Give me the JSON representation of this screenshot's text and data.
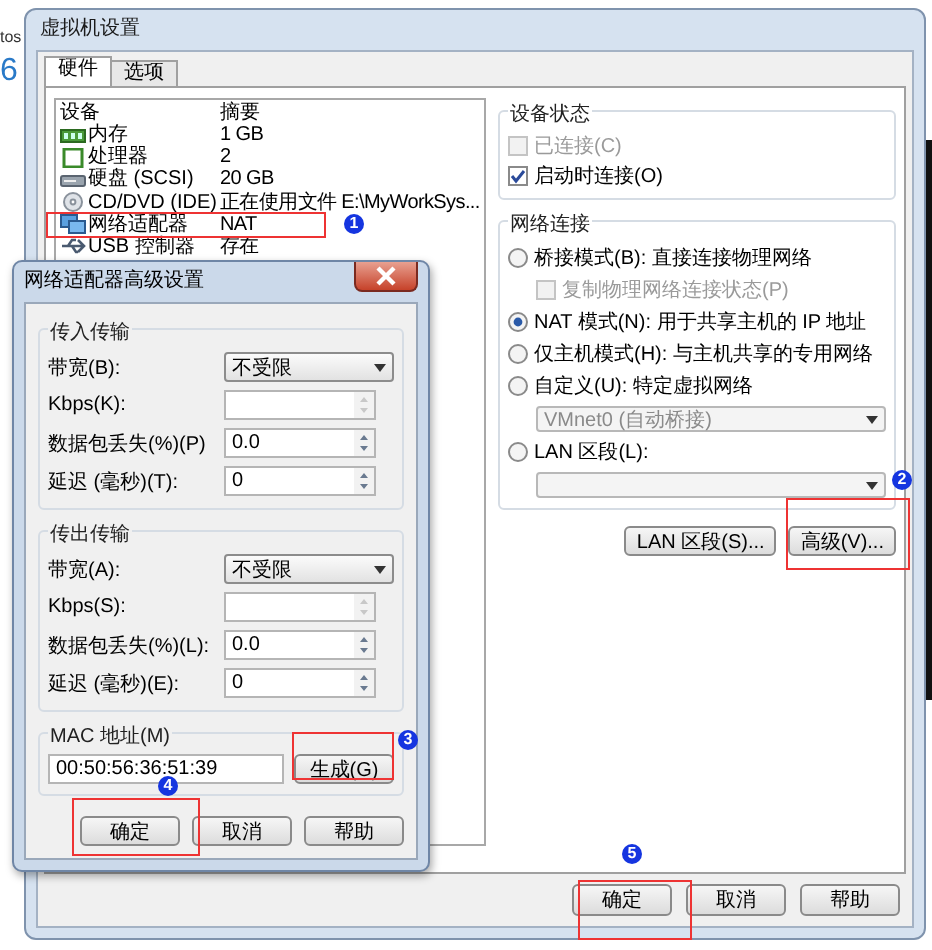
{
  "background_app": {
    "texts": [
      "tos",
      "6"
    ]
  },
  "main_window": {
    "title": "虚拟机设置",
    "tabs": [
      {
        "label": "硬件",
        "selected": true
      },
      {
        "label": "选项",
        "selected": false
      }
    ],
    "devices": {
      "columns": [
        "设备",
        "摘要"
      ],
      "rows": [
        {
          "device": "内存",
          "summary": "1 GB"
        },
        {
          "device": "处理器",
          "summary": "2"
        },
        {
          "device": "硬盘 (SCSI)",
          "summary": "20 GB"
        },
        {
          "device": "CD/DVD (IDE)",
          "summary": "正在使用文件 E:\\MyWorkSys..."
        },
        {
          "device": "网络适配器",
          "summary": "NAT"
        },
        {
          "device": "USB 控制器",
          "summary": "存在"
        }
      ]
    },
    "device_status": {
      "title": "设备状态",
      "options": [
        {
          "label": "已连接(C)",
          "checked": false,
          "disabled": true
        },
        {
          "label": "启动时连接(O)",
          "checked": true,
          "disabled": false
        }
      ]
    },
    "network": {
      "title": "网络连接",
      "options": [
        {
          "kind": "radio",
          "label": "桥接模式(B): 直接连接物理网络",
          "selected": false
        },
        {
          "kind": "checkbox",
          "label": "复制物理网络连接状态(P)",
          "checked": false,
          "disabled": true
        },
        {
          "kind": "radio",
          "label": "NAT 模式(N): 用于共享主机的 IP 地址",
          "selected": true
        },
        {
          "kind": "radio",
          "label": "仅主机模式(H): 与主机共享的专用网络",
          "selected": false
        },
        {
          "kind": "radio",
          "label": "自定义(U): 特定虚拟网络",
          "selected": false
        },
        {
          "kind": "select",
          "value": "VMnet0 (自动桥接)",
          "disabled": true
        },
        {
          "kind": "radio",
          "label": "LAN 区段(L):",
          "selected": false
        },
        {
          "kind": "select",
          "disabled": true
        }
      ]
    },
    "network_buttons": [
      "LAN 区段(S)...",
      "高级(V)..."
    ],
    "footer_buttons": [
      "确定",
      "取消",
      "帮助"
    ]
  },
  "advanced_dialog": {
    "title": "网络适配器高级设置",
    "groups": [
      {
        "title": "传入传输",
        "rows": [
          {
            "kind": "select",
            "label": "带宽(B):",
            "value": "不受限"
          },
          {
            "kind": "spin",
            "label": "Kbps(K):",
            "disabled": true
          },
          {
            "kind": "spin",
            "label": "数据包丢失(%)(P)",
            "value": "0.0",
            "disabled": false
          },
          {
            "kind": "spin",
            "label": "延迟 (毫秒)(T):",
            "value": "0",
            "disabled": false
          }
        ]
      },
      {
        "title": "传出传输",
        "rows": [
          {
            "kind": "select",
            "label": "带宽(A):",
            "value": "不受限"
          },
          {
            "kind": "spin",
            "label": "Kbps(S):",
            "disabled": true
          },
          {
            "kind": "spin",
            "label": "数据包丢失(%)(L):",
            "value": "0.0",
            "disabled": false
          },
          {
            "kind": "spin",
            "label": "延迟 (毫秒)(E):",
            "value": "0",
            "disabled": false
          }
        ]
      }
    ],
    "mac": {
      "title": "MAC 地址(M)",
      "value": "00:50:56:36:51:39",
      "button": "生成(G)"
    },
    "buttons": [
      "确定",
      "取消",
      "帮助"
    ]
  },
  "annotations": [
    {
      "label": "1"
    },
    {
      "label": "2"
    },
    {
      "label": "3"
    },
    {
      "label": "4"
    },
    {
      "label": "5"
    }
  ]
}
